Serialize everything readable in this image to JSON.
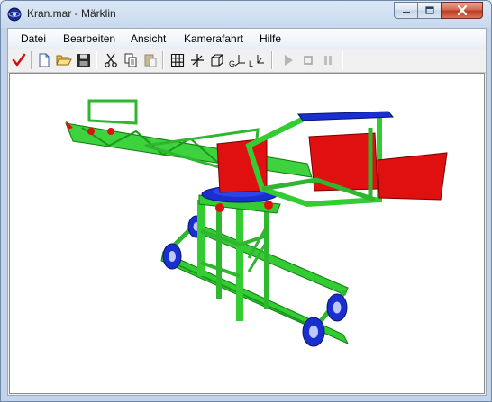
{
  "window": {
    "title": "Kran.mar - Märklin"
  },
  "menu": [
    {
      "label": "Datei"
    },
    {
      "label": "Bearbeiten"
    },
    {
      "label": "Ansicht"
    },
    {
      "label": "Kamerafahrt"
    },
    {
      "label": "Hilfe"
    }
  ],
  "toolbar": {
    "g_label": "G",
    "l_label": "L"
  },
  "colors": {
    "model_green": "#3fd23f",
    "model_red": "#e01010",
    "model_blue": "#1a2fd0"
  }
}
